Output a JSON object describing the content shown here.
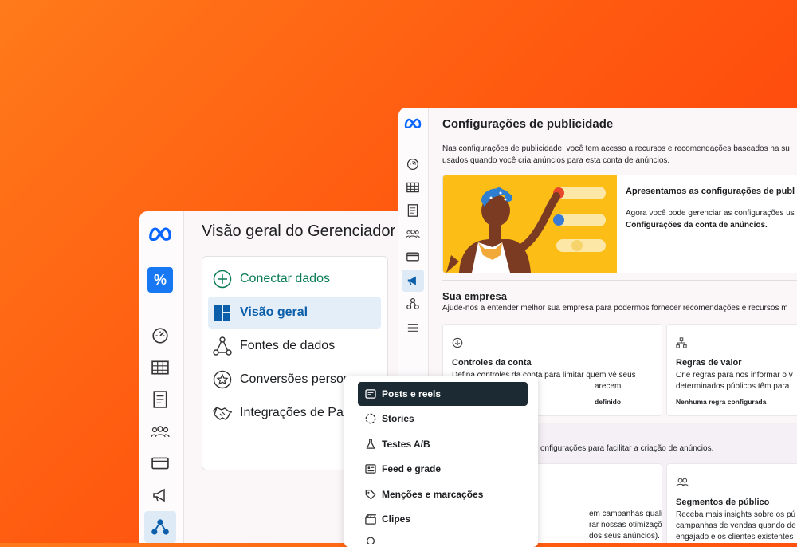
{
  "settings_window": {
    "title": "Configurações de publicidade",
    "description_line1": "Nas configurações de publicidade, você tem acesso a recursos e recomendações baseados na su",
    "description_line2": "usados quando você cria anúncios para esta conta de anúncios.",
    "promo": {
      "title": "Apresentamos as configurações de publ",
      "text_line1": "Agora você pode gerenciar as configurações us",
      "text_line2": "Configurações da conta de anúncios."
    },
    "company_section": {
      "title": "Sua empresa",
      "description": "Ajude-nos a entender melhor sua empresa para podermos fornecer recomendações e recursos m"
    },
    "account_controls_card": {
      "title": "Controles da conta",
      "line1": "Defina controles da conta para limitar quem vê seus",
      "line2": "arecem.",
      "status": "definido"
    },
    "value_rules_card": {
      "title": "Regras de valor",
      "line1": "Crie regras para nos informar o v",
      "line2": "determinados públicos têm para",
      "status": "Nenhuma regra configurada"
    },
    "settings_section_desc": "onfigurações para facilitar a criação de anúncios.",
    "campaign_card": {
      "line1": "em campanhas qualificadas",
      "line2": "rar nossas otimizações de",
      "line3": "dos seus anúncios)."
    },
    "audience_card": {
      "title": "Segmentos de público",
      "line1": "Receba mais insights sobre os pú",
      "line2": "campanhas de vendas quando de",
      "line3": "engajado e os clientes existentes"
    }
  },
  "overview_window": {
    "title": "Visão geral do Gerenciador",
    "nav": [
      {
        "label": "Conectar dados",
        "icon": "plus-circle-icon"
      },
      {
        "label": "Visão geral",
        "icon": "dashboard-layout-icon"
      },
      {
        "label": "Fontes de dados",
        "icon": "data-sources-icon"
      },
      {
        "label": "Conversões person",
        "icon": "star-badge-icon"
      },
      {
        "label": "Integrações de Pa",
        "icon": "handshake-icon"
      }
    ]
  },
  "menu": {
    "items": [
      {
        "label": "Posts e reels",
        "icon": "post-icon"
      },
      {
        "label": "Stories",
        "icon": "stories-ring-icon"
      },
      {
        "label": "Testes A/B",
        "icon": "flask-icon"
      },
      {
        "label": "Feed e grade",
        "icon": "feed-grid-icon"
      },
      {
        "label": "Menções e marcações",
        "icon": "tag-icon"
      },
      {
        "label": "Clipes",
        "icon": "clapper-icon"
      }
    ]
  },
  "colors": {
    "background_orange": "#ff5a10",
    "active_blue": "#0b5eaa",
    "active_bg": "#e4eef9",
    "connect_green": "#0a7c57",
    "menu_active": "#1c2b33",
    "meta_blue": "#0866ff",
    "promo_yellow": "#fbbd16"
  }
}
